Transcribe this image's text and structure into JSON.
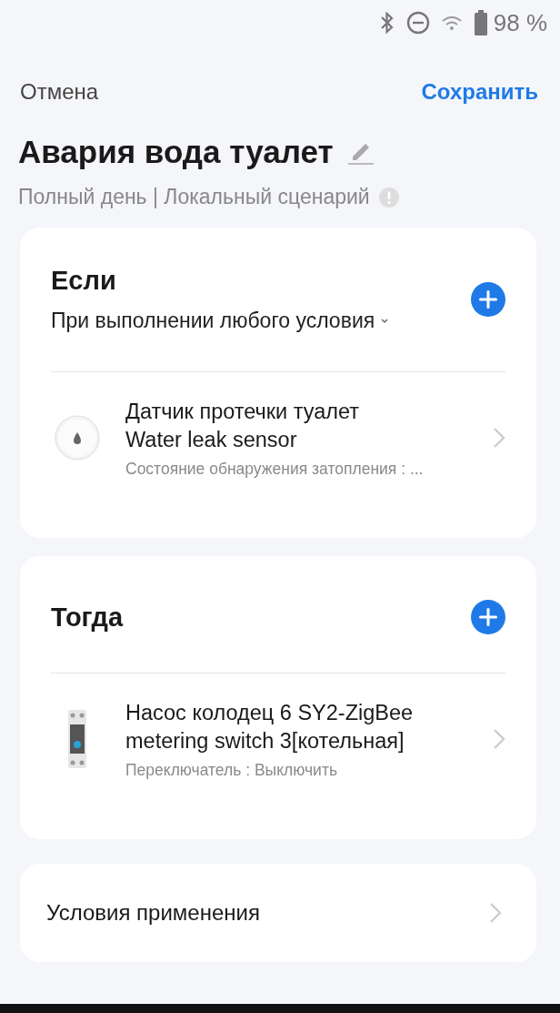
{
  "status_bar": {
    "battery": "98 %"
  },
  "header": {
    "cancel": "Отмена",
    "save": "Сохранить"
  },
  "scene": {
    "title": "Авария вода туалет",
    "subtitle": "Полный день | Локальный сценарий"
  },
  "sections": [
    {
      "title": "Если",
      "condition_mode": "При выполнении любого условия",
      "devices": [
        {
          "kind": "sensor",
          "title_lines": [
            "Датчик протечки туалет",
            "Water leak sensor"
          ],
          "detail": "Состояние обнаружения затопления : ..."
        }
      ]
    },
    {
      "title": "Тогда",
      "devices": [
        {
          "kind": "switch",
          "title_lines": [
            "Насос колодец 6 SY2-ZigBee",
            "metering switch 3[котельная]"
          ],
          "detail": "Переключатель : Выключить"
        }
      ]
    }
  ],
  "footer_item": {
    "label": "Условия применения"
  }
}
